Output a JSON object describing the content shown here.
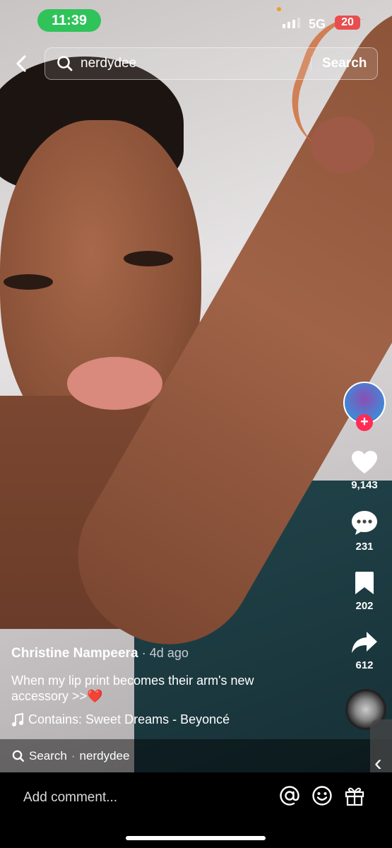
{
  "status_bar": {
    "time": "11:39",
    "network": "5G",
    "battery": "20",
    "time_pill_color": "#2fc35a",
    "battery_color": "#e84e4e"
  },
  "search": {
    "query": "nerdydee",
    "button_label": "Search"
  },
  "right_rail": {
    "likes": "9,143",
    "comments": "231",
    "bookmarks": "202",
    "shares": "612",
    "follow_symbol": "+",
    "accent": "#ff2c55"
  },
  "post": {
    "author": "Christine Nampeera",
    "time_ago": "· 4d ago",
    "caption": "When my lip print becomes their arm's new accessory >>❤️",
    "music": "Contains: Sweet Dreams - Beyoncé"
  },
  "search_strip": {
    "label": "Search",
    "separator": "·",
    "query": "nerdydee"
  },
  "comment_bar": {
    "placeholder": "Add comment..."
  },
  "side_handle": {
    "glyph": "‹"
  }
}
